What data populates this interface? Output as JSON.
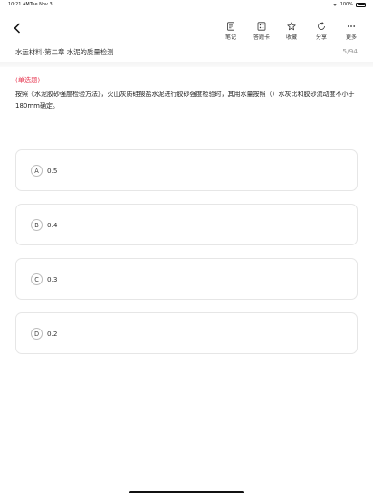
{
  "status": {
    "time": "10:21 AM",
    "day": "Tue Nov 3",
    "battery": "100%"
  },
  "toolbar": {
    "items": [
      {
        "label": "笔记",
        "icon": "note-icon"
      },
      {
        "label": "答题卡",
        "icon": "answer-card-icon"
      },
      {
        "label": "收藏",
        "icon": "star-icon"
      },
      {
        "label": "分享",
        "icon": "share-icon"
      },
      {
        "label": "更多",
        "icon": "more-icon"
      }
    ]
  },
  "chapter": {
    "title": "水运材料-第二章  水泥的质量检测",
    "progress": "5/94"
  },
  "question": {
    "type": "(单选题)",
    "text": "按照《水泥胶砂强度检验方法》，火山灰质硅酸盐水泥进行胶砂强度检验时，其用水量按照（）水灰比和胶砂流动度不小于180mm确定。",
    "options": [
      {
        "letter": "A",
        "value": "0.5"
      },
      {
        "letter": "B",
        "value": "0.4"
      },
      {
        "letter": "C",
        "value": "0.3"
      },
      {
        "letter": "D",
        "value": "0.2"
      }
    ]
  },
  "colors": {
    "accent": "#e8425a",
    "border": "#e6e6e6"
  }
}
